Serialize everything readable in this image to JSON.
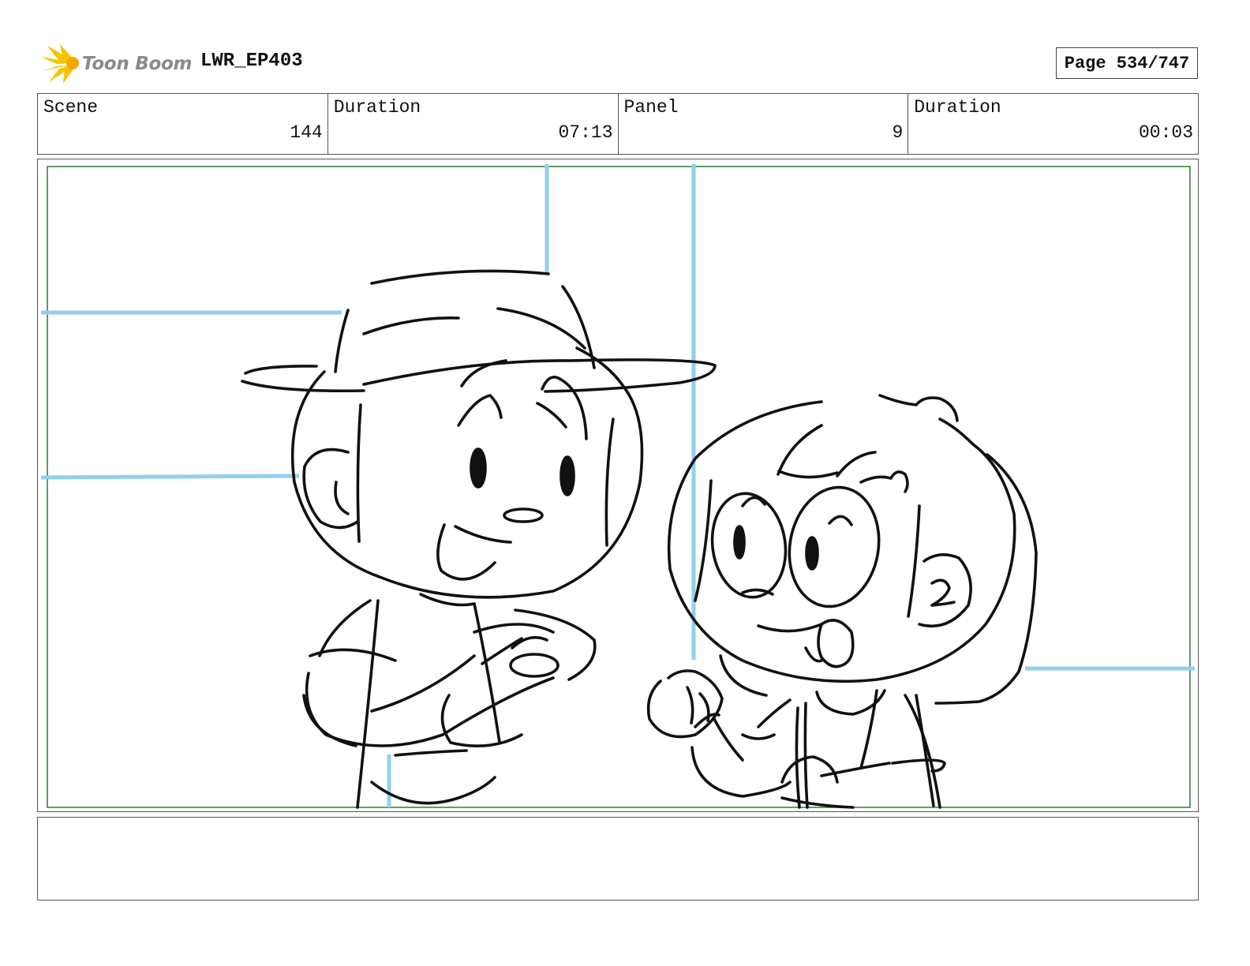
{
  "header": {
    "logo_text": "Toon Boom",
    "project": "LWR_EP403",
    "page": "Page 534/747"
  },
  "info": [
    {
      "label": "Scene",
      "value": "144"
    },
    {
      "label": "Duration",
      "value": "07:13"
    },
    {
      "label": "Panel",
      "value": "9"
    },
    {
      "label": "Duration",
      "value": "00:03"
    }
  ],
  "panel": {
    "description": "",
    "colors": {
      "guide_lines": "#8fd0f0",
      "safe_frame": "#2e7d2e",
      "sketch": "#111111"
    }
  },
  "notes": {
    "text": ""
  }
}
